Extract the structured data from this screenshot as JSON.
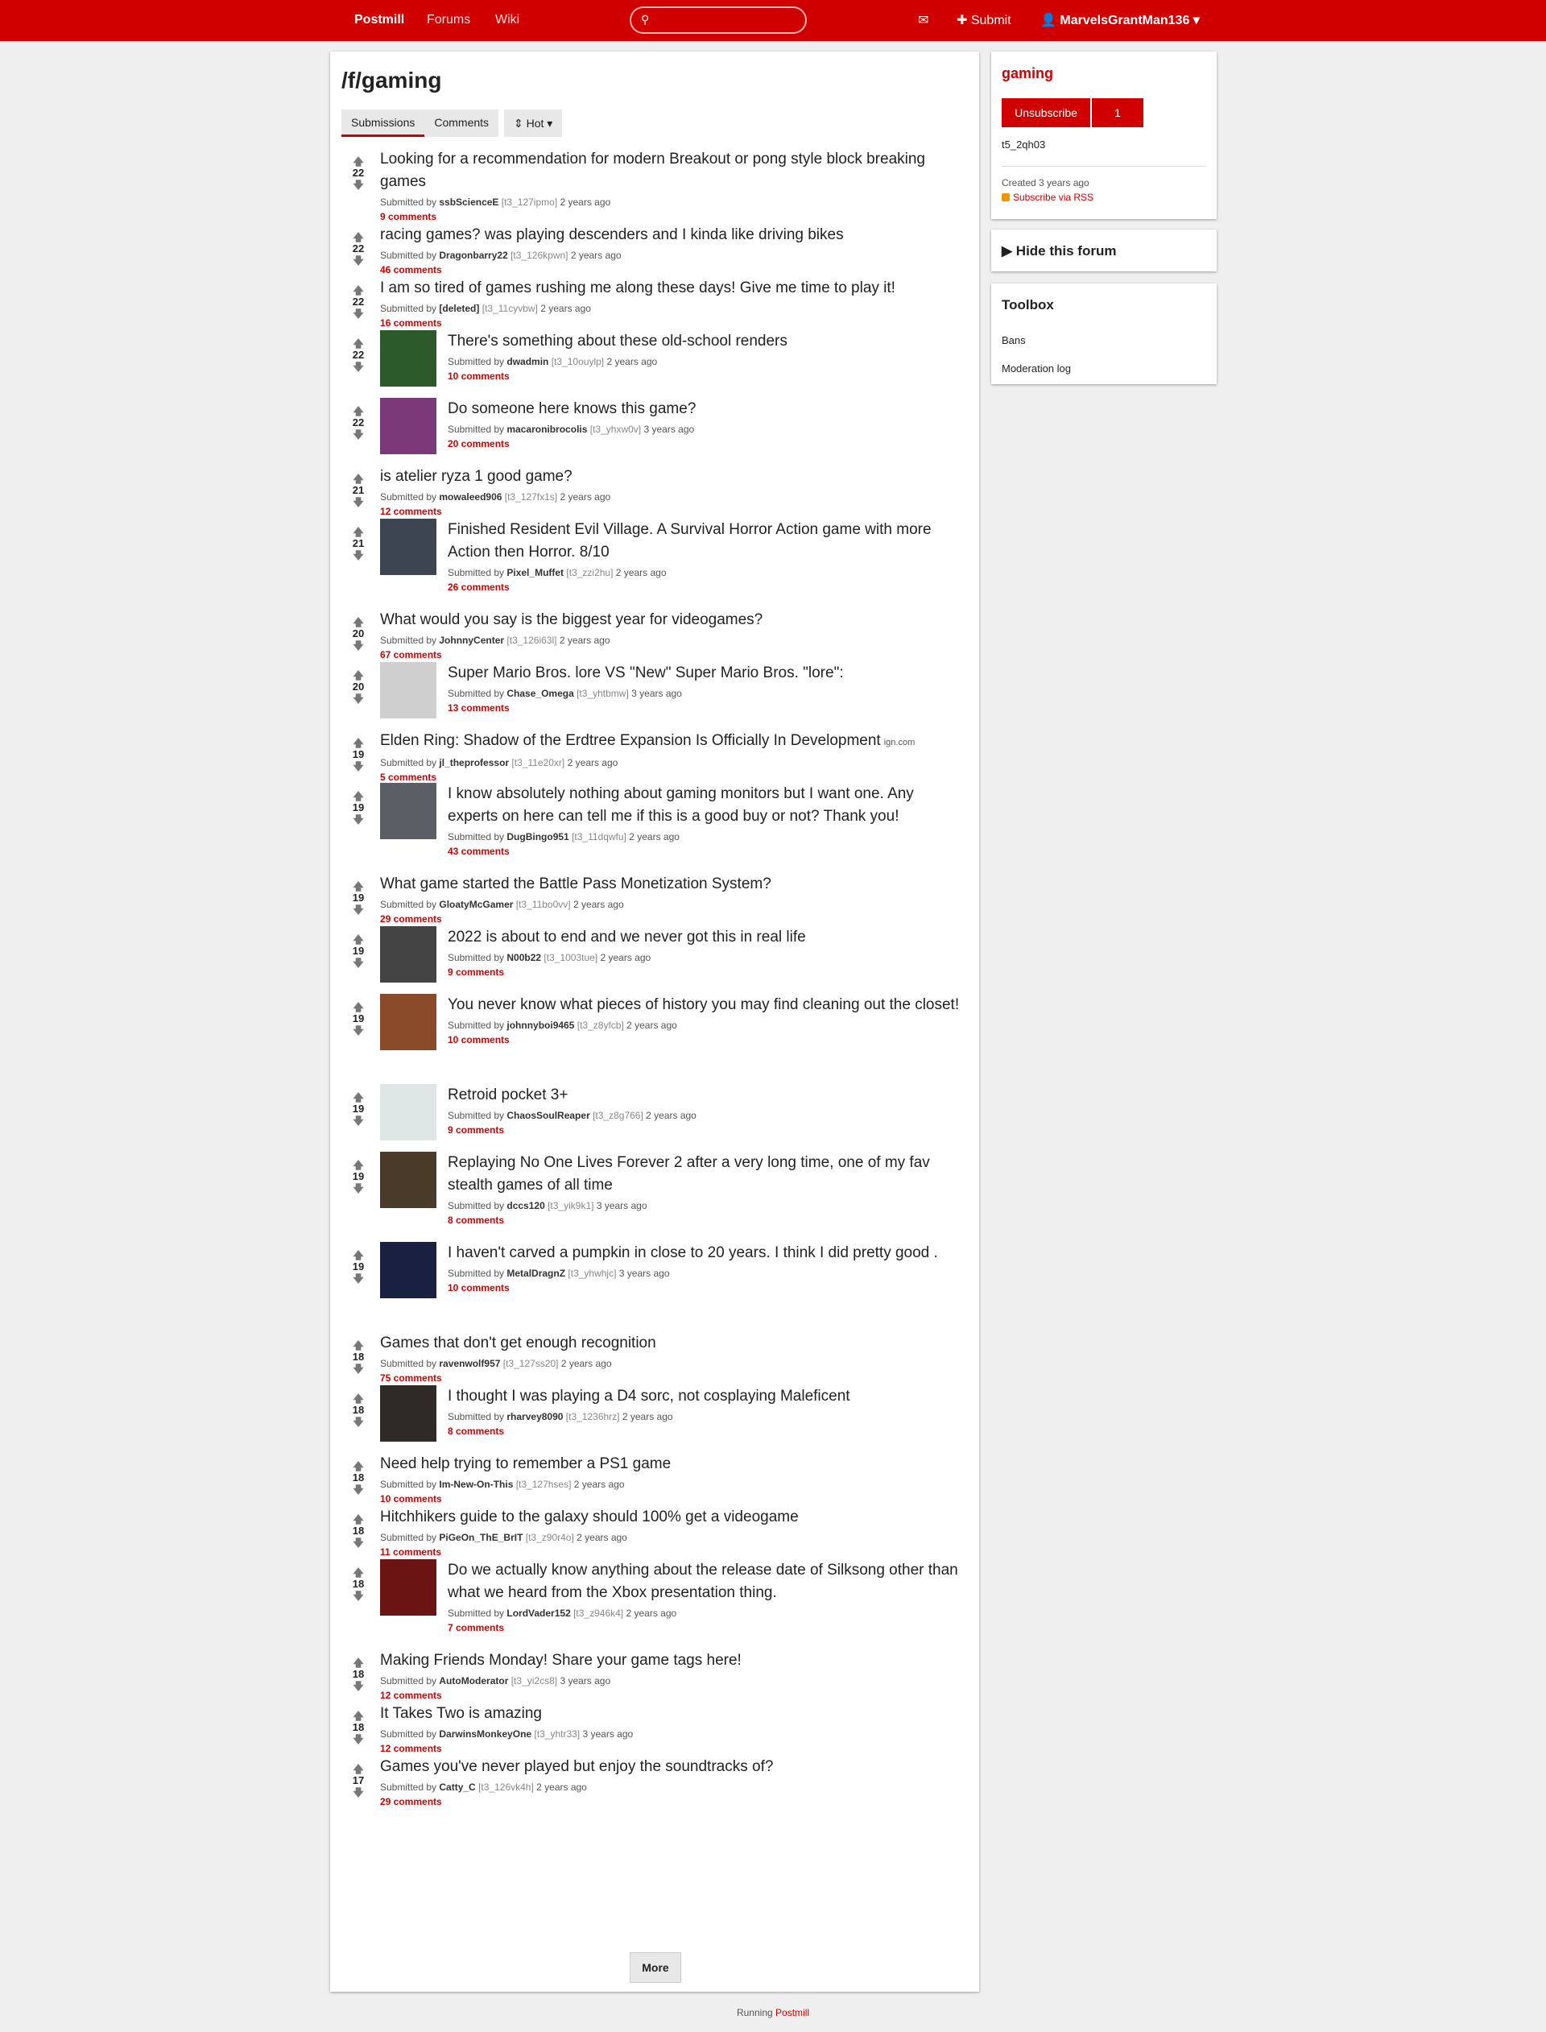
{
  "nav": {
    "brand": "Postmill",
    "forums": "Forums",
    "wiki": "Wiki",
    "search_placeholder": "",
    "submit": "✚ Submit",
    "user": "MarvelsGrantMan136"
  },
  "forum": {
    "title": "/f/gaming",
    "tabs": [
      "Submissions",
      "Comments"
    ],
    "sort": "Hot"
  },
  "submissions": [
    {
      "score": "22",
      "title": "Looking for a recommendation for modern Breakout or pong style block breaking games",
      "by": "ssbScienceE",
      "tid": "[t3_127ipmo]",
      "age": "2 years ago",
      "comments": "9 comments",
      "thumb": false
    },
    {
      "score": "22",
      "title": "racing games? was playing descenders and I kinda like driving bikes",
      "by": "Dragonbarry22",
      "tid": "[t3_126kpwn]",
      "age": "2 years ago",
      "comments": "46 comments",
      "thumb": false
    },
    {
      "score": "22",
      "title": "I am so tired of games rushing me along these days! Give me time to play it!",
      "by": "[deleted]",
      "tid": "[t3_11cyvbw]",
      "age": "2 years ago",
      "comments": "16 comments",
      "thumb": false
    },
    {
      "score": "22",
      "title": "There's something about these old-school renders",
      "by": "dwadmin",
      "tid": "[t3_10ouylp]",
      "age": "2 years ago",
      "comments": "10 comments",
      "thumb": true,
      "thumb_color": "#2d5a2b"
    },
    {
      "score": "22",
      "title": "Do someone here knows this game?",
      "by": "macaronibrocolis",
      "tid": "[t3_yhxw0v]",
      "age": "3 years ago",
      "comments": "20 comments",
      "thumb": true,
      "thumb_color": "#7a3a7a"
    },
    {
      "score": "21",
      "title": "is atelier ryza 1 good game?",
      "by": "mowaleed906",
      "tid": "[t3_127fx1s]",
      "age": "2 years ago",
      "comments": "12 comments",
      "thumb": false
    },
    {
      "score": "21",
      "title": "Finished Resident Evil Village. A Survival Horror Action game with more Action then Horror. 8/10",
      "by": "Pixel_Muffet",
      "tid": "[t3_zzi2hu]",
      "age": "2 years ago",
      "comments": "26 comments",
      "thumb": true,
      "thumb_color": "#3c4550"
    },
    {
      "score": "20",
      "title": "What would you say is the biggest year for videogames?",
      "by": "JohnnyCenter",
      "tid": "[t3_126i63l]",
      "age": "2 years ago",
      "comments": "67 comments",
      "thumb": false
    },
    {
      "score": "20",
      "title": "Super Mario Bros. lore VS \"New\" Super Mario Bros. \"lore\":",
      "by": "Chase_Omega",
      "tid": "[t3_yhtbmw]",
      "age": "3 years ago",
      "comments": "13 comments",
      "thumb": true,
      "thumb_color": "#cfcfcf"
    },
    {
      "score": "19",
      "title": "Elden Ring: Shadow of the Erdtree Expansion Is Officially In Development",
      "domain": "ign.com",
      "by": "jl_theprofessor",
      "tid": "[t3_11e20xr]",
      "age": "2 years ago",
      "comments": "5 comments",
      "thumb": false
    },
    {
      "score": "19",
      "title": "I know absolutely nothing about gaming monitors but I want one. Any experts on here can tell me if this is a good buy or not? Thank you!",
      "by": "DugBingo951",
      "tid": "[t3_11dqwfu]",
      "age": "2 years ago",
      "comments": "43 comments",
      "thumb": true,
      "thumb_color": "#5a5f66"
    },
    {
      "score": "19",
      "title": "What game started the Battle Pass Monetization System?",
      "by": "GloatyMcGamer",
      "tid": "[t3_11bo0vv]",
      "age": "2 years ago",
      "comments": "29 comments",
      "thumb": false
    },
    {
      "score": "19",
      "title": "2022 is about to end and we never got this in real life",
      "by": "N00b22",
      "tid": "[t3_1003tue]",
      "age": "2 years ago",
      "comments": "9 comments",
      "thumb": true,
      "thumb_color": "#444"
    },
    {
      "score": "19",
      "title": "You never know what pieces of history you may find cleaning out the closet!",
      "by": "johnnyboi9465",
      "tid": "[t3_z8yfcb]",
      "age": "2 years ago",
      "comments": "10 comments",
      "thumb": true,
      "thumb_color": "#8a4b2a"
    },
    {
      "score": "19",
      "title": "Retroid pocket 3+",
      "by": "ChaosSoulReaper",
      "tid": "[t3_z8g766]",
      "age": "2 years ago",
      "comments": "9 comments",
      "thumb": true,
      "thumb_color": "#dfe6e6"
    },
    {
      "score": "19",
      "title": "Replaying No One Lives Forever 2 after a very long time, one of my fav stealth games of all time",
      "by": "dccs120",
      "tid": "[t3_yik9k1]",
      "age": "3 years ago",
      "comments": "8 comments",
      "thumb": true,
      "thumb_color": "#4a3a2a"
    },
    {
      "score": "19",
      "title": "I haven't carved a pumpkin in close to 20 years. I think I did pretty good .",
      "by": "MetalDragnZ",
      "tid": "[t3_yhwhjc]",
      "age": "3 years ago",
      "comments": "10 comments",
      "thumb": true,
      "thumb_color": "#1a2040"
    },
    {
      "score": "18",
      "title": "Games that don't get enough recognition",
      "by": "ravenwolf957",
      "tid": "[t3_127ss20]",
      "age": "2 years ago",
      "comments": "75 comments",
      "thumb": false
    },
    {
      "score": "18",
      "title": "I thought I was playing a D4 sorc, not cosplaying Maleficent",
      "by": "rharvey8090",
      "tid": "[t3_1236hrz]",
      "age": "2 years ago",
      "comments": "8 comments",
      "thumb": true,
      "thumb_color": "#2f2a26"
    },
    {
      "score": "18",
      "title": "Need help trying to remember a PS1 game",
      "by": "Im-New-On-This",
      "tid": "[t3_127hses]",
      "age": "2 years ago",
      "comments": "10 comments",
      "thumb": false
    },
    {
      "score": "18",
      "title": "Hitchhikers guide to the galaxy should 100% get a videogame",
      "by": "PiGeOn_ThE_BrIT",
      "tid": "[t3_z90r4o]",
      "age": "2 years ago",
      "comments": "11 comments",
      "thumb": false
    },
    {
      "score": "18",
      "title": "Do we actually know anything about the release date of Silksong other than what we heard from the Xbox presentation thing.",
      "by": "LordVader152",
      "tid": "[t3_z946k4]",
      "age": "2 years ago",
      "comments": "7 comments",
      "thumb": true,
      "thumb_color": "#6b1414"
    },
    {
      "score": "18",
      "title": "Making Friends Monday! Share your game tags here!",
      "by": "AutoModerator",
      "tid": "[t3_yi2cs8]",
      "age": "3 years ago",
      "comments": "12 comments",
      "thumb": false
    },
    {
      "score": "18",
      "title": "It Takes Two is amazing",
      "by": "DarwinsMonkeyOne",
      "tid": "[t3_yhtr33]",
      "age": "3 years ago",
      "comments": "12 comments",
      "thumb": false
    },
    {
      "score": "17",
      "title": "Games you've never played but enjoy the soundtracks of?",
      "by": "Catty_C",
      "tid": "[t3_126vk4h]",
      "age": "2 years ago",
      "comments": "29 comments",
      "thumb": false
    }
  ],
  "more_label": "More",
  "sidebar": {
    "forum_name": "gaming",
    "unsubscribe": "Unsubscribe",
    "subscriber_count": "1",
    "forum_id": "t5_2qh03",
    "created": "Created 3 years ago",
    "rss": "Subscribe via RSS",
    "hide_forum": "Hide this forum",
    "toolbox_title": "Toolbox",
    "toolbox_items": [
      "Bans",
      "Moderation log"
    ]
  },
  "footer": {
    "running": "Running",
    "brand": "Postmill"
  }
}
